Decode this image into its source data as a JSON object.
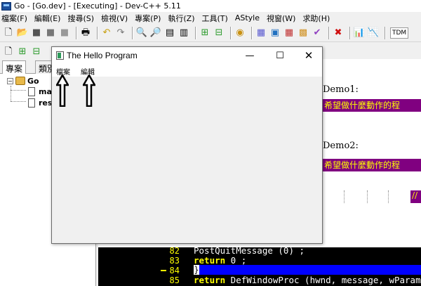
{
  "ide": {
    "title": "Go - [Go.dev] - [Executing] - Dev-C++ 5.11",
    "menu": [
      "檔案(F)",
      "編輯(E)",
      "搜尋(S)",
      "檢視(V)",
      "專案(P)",
      "執行(Z)",
      "工具(T)",
      "AStyle",
      "視窗(W)",
      "求助(H)"
    ],
    "toolbar_right_label": "TDM"
  },
  "project_panel": {
    "tabs": [
      "專案",
      "類別"
    ],
    "root": "Go",
    "files": [
      "ma",
      "res"
    ]
  },
  "editor": {
    "fragments": {
      "demo1": "Demo1:",
      "demo2": "Demo2:",
      "comment1": "希望做什麼動作的程",
      "comment2": "希望做什麼動作的程",
      "slashes": "//"
    },
    "lines": [
      {
        "num": "82",
        "code": "PostQuitMessage (0) ;"
      },
      {
        "num": "83",
        "kw": "return",
        "code": " 0 ;"
      },
      {
        "num": "84",
        "code": "}"
      },
      {
        "num": "85",
        "kw": "return",
        "code": " DefWindowProc (hwnd, message, wParam"
      }
    ]
  },
  "hello_window": {
    "title": "The Hello Program",
    "menu": [
      "檔案",
      "編輯"
    ]
  }
}
